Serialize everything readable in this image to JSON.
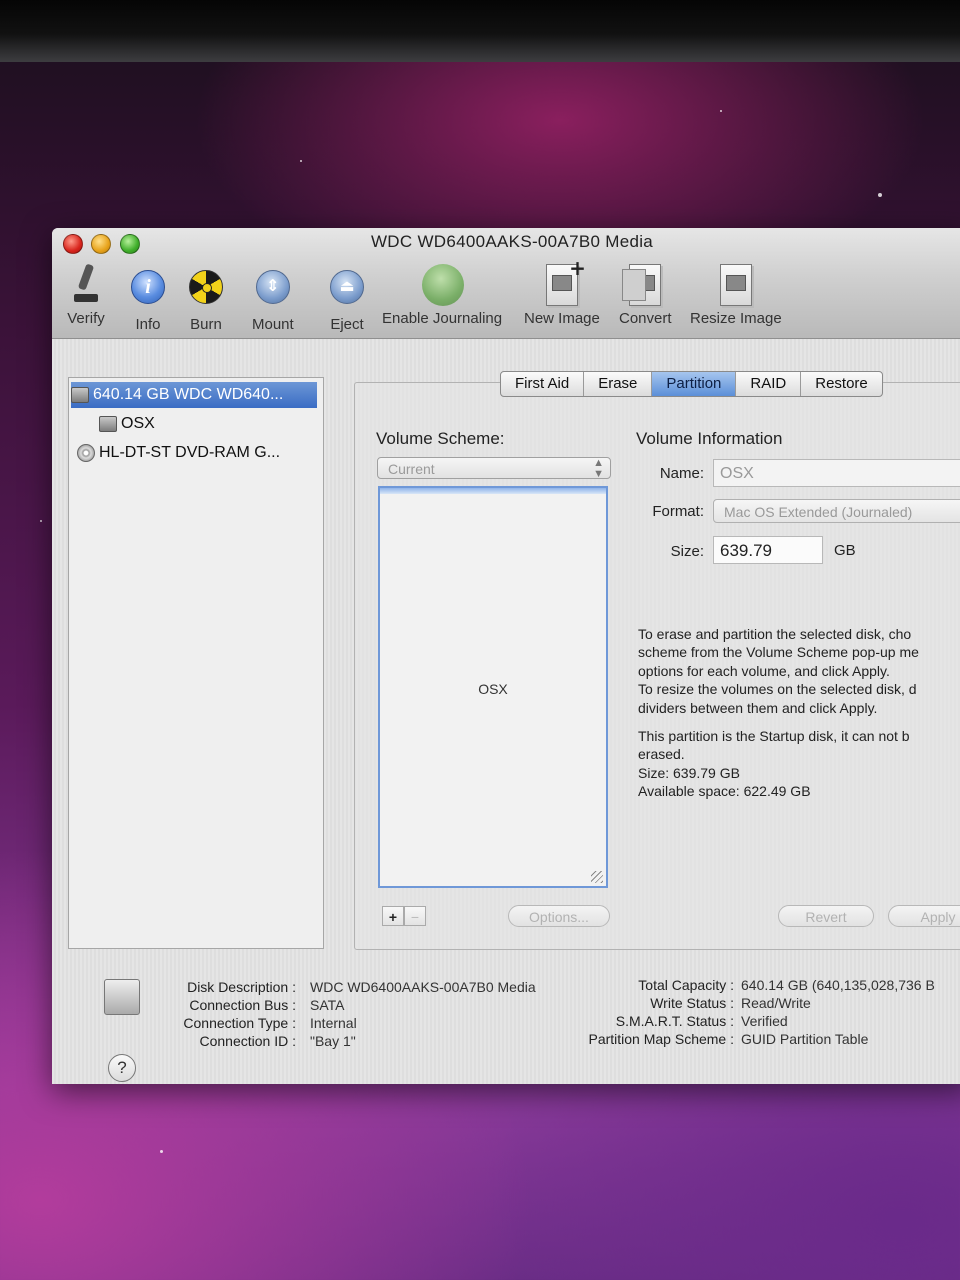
{
  "window": {
    "title": "WDC WD6400AAKS-00A7B0 Media"
  },
  "toolbar": [
    {
      "label": "Verify",
      "icon": "microscope-icon"
    },
    {
      "label": "Info",
      "icon": "info-icon"
    },
    {
      "label": "Burn",
      "icon": "burn-icon"
    },
    {
      "label": "Mount",
      "icon": "mount-icon"
    },
    {
      "label": "Eject",
      "icon": "eject-icon"
    },
    {
      "label": "Enable Journaling",
      "icon": "journaling-icon"
    },
    {
      "label": "New Image",
      "icon": "new-image-icon"
    },
    {
      "label": "Convert",
      "icon": "convert-icon"
    },
    {
      "label": "Resize Image",
      "icon": "resize-image-icon"
    }
  ],
  "sidebar": {
    "items": [
      {
        "label": "640.14 GB WDC WD640...",
        "selected": true
      },
      {
        "label": "OSX",
        "selected": false
      },
      {
        "label": "HL-DT-ST DVD-RAM G...",
        "selected": false
      }
    ]
  },
  "tabs": [
    "First Aid",
    "Erase",
    "Partition",
    "RAID",
    "Restore"
  ],
  "active_tab": "Partition",
  "volume_scheme": {
    "label": "Volume Scheme:",
    "popup_value": "Current",
    "partition_name": "OSX",
    "add_label": "+",
    "remove_label": "−",
    "options_label": "Options..."
  },
  "volume_info": {
    "title": "Volume Information",
    "name_label": "Name:",
    "name_value": "OSX",
    "format_label": "Format:",
    "format_value": "Mac OS Extended (Journaled)",
    "size_label": "Size:",
    "size_value": "639.79",
    "size_unit": "GB",
    "help_lines": [
      "To erase and partition the selected disk, cho",
      "scheme from the Volume Scheme pop-up me",
      "options for each volume, and click Apply.",
      "To resize the volumes on the selected disk, d",
      "dividers between them and click Apply."
    ],
    "startup_lines": [
      "This partition is the Startup disk, it can not b",
      "erased.",
      "Size: 639.79 GB",
      "Available space: 622.49 GB"
    ]
  },
  "actions": {
    "revert_label": "Revert",
    "apply_label": "Apply"
  },
  "disk_details": {
    "left": [
      {
        "key": "Disk Description :",
        "value": "WDC WD6400AAKS-00A7B0 Media"
      },
      {
        "key": "Connection Bus :",
        "value": "SATA"
      },
      {
        "key": "Connection Type :",
        "value": "Internal"
      },
      {
        "key": "Connection ID :",
        "value": "\"Bay 1\""
      }
    ],
    "right": [
      {
        "key": "Total Capacity :",
        "value": "640.14 GB (640,135,028,736 B"
      },
      {
        "key": "Write Status :",
        "value": "Read/Write"
      },
      {
        "key": "S.M.A.R.T. Status :",
        "value": "Verified"
      },
      {
        "key": "Partition Map Scheme :",
        "value": "GUID Partition Table"
      }
    ]
  },
  "help_button": "?"
}
